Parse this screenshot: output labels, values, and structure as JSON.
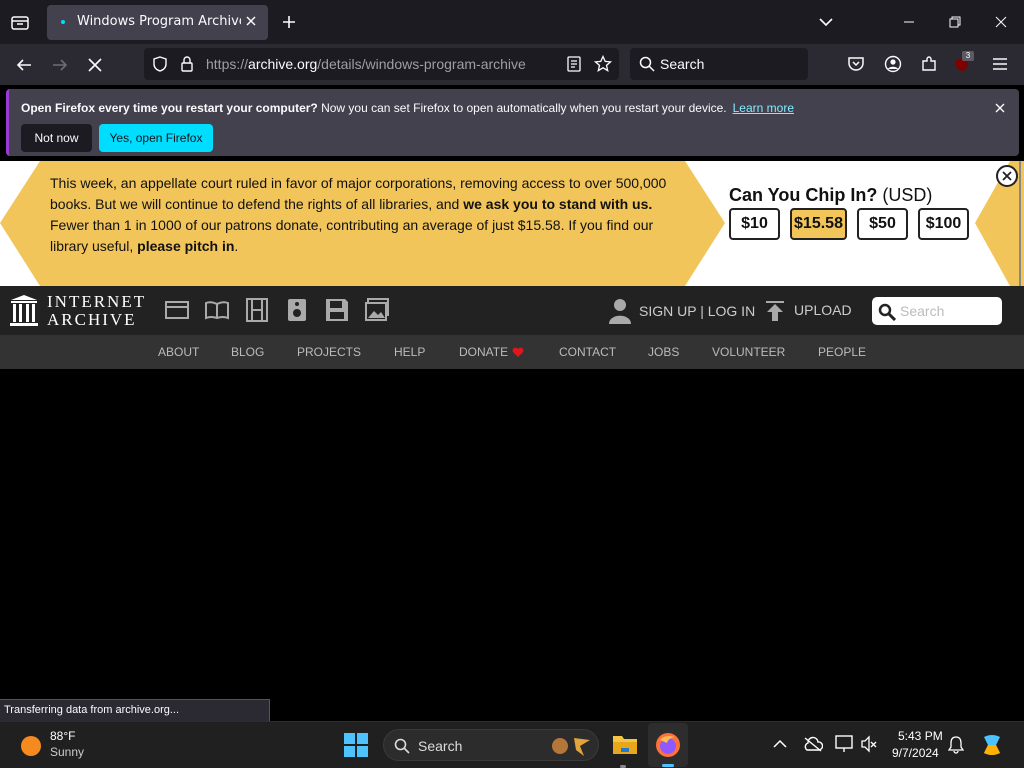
{
  "browser": {
    "tab_title": "Windows Program Archive : No",
    "url_prefix": "https://",
    "url_host": "archive.org",
    "url_path": "/details/windows-program-archive",
    "search_label": "Search",
    "extension_badge": "3"
  },
  "notification": {
    "bold_text": "Open Firefox every time you restart your computer?",
    "text": " Now you can set Firefox to open automatically when you restart your device.",
    "learn_more": "Learn more",
    "not_now": "Not now",
    "yes_open": "Yes, open Firefox"
  },
  "donation": {
    "line1": "This week, an appellate court ruled in favor of major corporations, removing access to over 500,000 books. But we will continue to defend the rights of all libraries, and ",
    "line1_bold": "we ask you to stand with us.",
    "line2": "Fewer than 1 in 1000 of our patrons donate, contributing an average of just $15.58. If you find our library useful, ",
    "line2_bold": "please pitch in",
    "line2_end": ".",
    "chip_title": "Can You Chip In?",
    "chip_currency": " (USD)",
    "amounts": [
      "$10",
      "$15.58",
      "$50",
      "$100"
    ],
    "selected_amount": "$15.58"
  },
  "ia_header": {
    "logo_line1": "INTERNET",
    "logo_line2": "ARCHIVE",
    "signup": "SIGN UP | LOG IN",
    "upload": "UPLOAD",
    "search_placeholder": "Search"
  },
  "subnav": [
    "ABOUT",
    "BLOG",
    "PROJECTS",
    "HELP",
    "DONATE",
    "CONTACT",
    "JOBS",
    "VOLUNTEER",
    "PEOPLE"
  ],
  "status_text": "Transferring data from archive.org...",
  "taskbar": {
    "temp": "88°F",
    "condition": "Sunny",
    "search_label": "Search",
    "time": "5:43 PM",
    "date": "9/7/2024"
  }
}
